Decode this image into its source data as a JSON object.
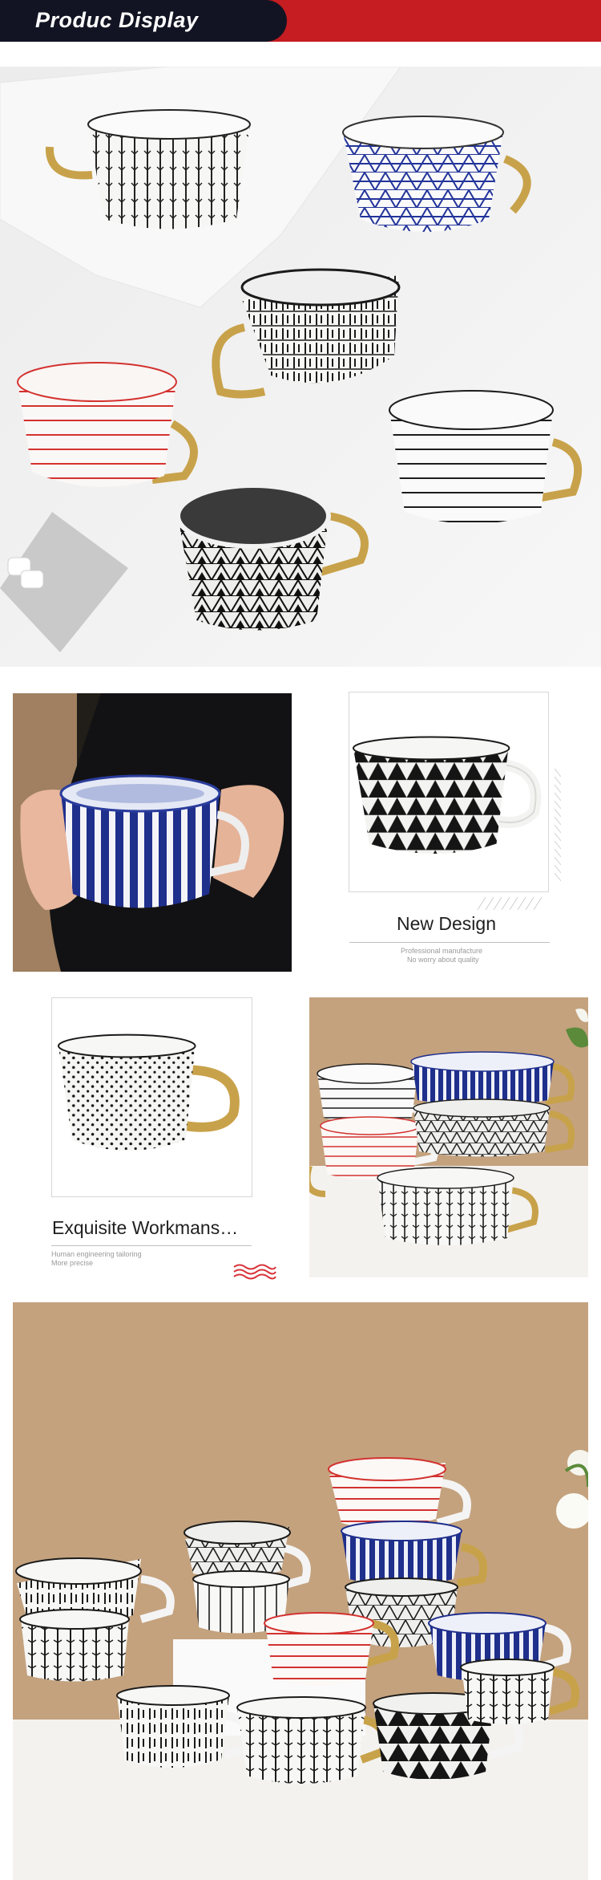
{
  "header": {
    "title": "Produc Display",
    "left_color": "#131423",
    "right_color": "#c51d21"
  },
  "gallery": {
    "hero_image": "white mugs with gold handles in various geometric patterns on a marble board",
    "hand_image": "hands holding a blue striped mug",
    "stack_image": "stacked patterned mugs on a white shelf",
    "group_image": "many patterned mugs grouped on a shelf"
  },
  "features": [
    {
      "title": "New Design",
      "sub1": "Professional manufacture",
      "sub2": "No worry about quality"
    },
    {
      "title": "Exquisite Workmans…",
      "sub1": "Human engineering tailoring",
      "sub2": "More precise"
    }
  ],
  "colors": {
    "accent_red": "#c51d21",
    "navy": "#131423",
    "wave_red": "#d9343a",
    "cobalt": "#1f2f8c",
    "gold": "#c8a24a",
    "backdrop_tan": "#c4a27e"
  }
}
